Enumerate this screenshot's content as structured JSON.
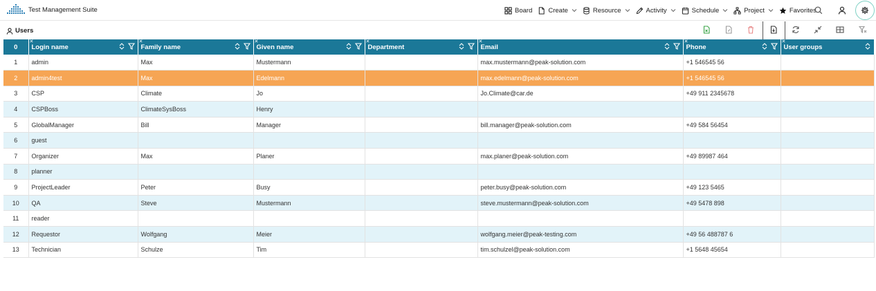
{
  "app": {
    "title": "Test Management Suite"
  },
  "nav": {
    "items": [
      {
        "label": "Board",
        "icon": "board-icon",
        "chevron": false
      },
      {
        "label": "Create",
        "icon": "document-icon",
        "chevron": true
      },
      {
        "label": "Resource",
        "icon": "database-icon",
        "chevron": true
      },
      {
        "label": "Activity",
        "icon": "pencil-icon",
        "chevron": true
      },
      {
        "label": "Schedule",
        "icon": "calendar-icon",
        "chevron": true
      },
      {
        "label": "Project",
        "icon": "hierarchy-icon",
        "chevron": true
      },
      {
        "label": "Favorites",
        "icon": "star-icon",
        "chevron": false
      }
    ]
  },
  "page": {
    "title": "Users"
  },
  "colors": {
    "header_bg": "#1b7898",
    "selected_row": "#f6a554",
    "stripe": "#e2f3f9",
    "accent_ring": "#7fd1c4"
  },
  "table": {
    "columns": [
      {
        "label": "0"
      },
      {
        "label": "Login name"
      },
      {
        "label": "Family name"
      },
      {
        "label": "Given name"
      },
      {
        "label": "Department"
      },
      {
        "label": "Email"
      },
      {
        "label": "Phone"
      },
      {
        "label": "User groups"
      }
    ],
    "selected_index": 1,
    "rows": [
      {
        "no": "1",
        "login": "admin",
        "family": "Max",
        "given": "Mustermann",
        "department": "",
        "email": "max.mustermann@peak-solution.com",
        "phone": "+1 546545 56",
        "groups": ""
      },
      {
        "no": "2",
        "login": "admin4test",
        "family": "Max",
        "given": "Edelmann",
        "department": "",
        "email": "max.edelmann@peak-solution.com",
        "phone": "+1 546545 56",
        "groups": ""
      },
      {
        "no": "3",
        "login": "CSP",
        "family": "Climate",
        "given": "Jo",
        "department": "",
        "email": "Jo.Climate@car.de",
        "phone": "+49 911 2345678",
        "groups": ""
      },
      {
        "no": "4",
        "login": "CSPBoss",
        "family": "ClimateSysBoss",
        "given": "Henry",
        "department": "",
        "email": "",
        "phone": "",
        "groups": ""
      },
      {
        "no": "5",
        "login": "GlobalManager",
        "family": "Bill",
        "given": "Manager",
        "department": "",
        "email": "bill.manager@peak-solution.com",
        "phone": "+49 584 56454",
        "groups": ""
      },
      {
        "no": "6",
        "login": "guest",
        "family": "",
        "given": "",
        "department": "",
        "email": "",
        "phone": "",
        "groups": ""
      },
      {
        "no": "7",
        "login": "Organizer",
        "family": "Max",
        "given": "Planer",
        "department": "",
        "email": "max.planer@peak-solution.com",
        "phone": "+49 89987 464",
        "groups": ""
      },
      {
        "no": "8",
        "login": "planner",
        "family": "",
        "given": "",
        "department": "",
        "email": "",
        "phone": "",
        "groups": ""
      },
      {
        "no": "9",
        "login": "ProjectLeader",
        "family": "Peter",
        "given": "Busy",
        "department": "",
        "email": "peter.busy@peak-solution.com",
        "phone": "+49 123 5465",
        "groups": ""
      },
      {
        "no": "10",
        "login": "QA",
        "family": "Steve",
        "given": "Mustermann",
        "department": "",
        "email": "steve.mustermann@peak-solution.com",
        "phone": "+49 5478 898",
        "groups": ""
      },
      {
        "no": "11",
        "login": "reader",
        "family": "",
        "given": "",
        "department": "",
        "email": "",
        "phone": "",
        "groups": ""
      },
      {
        "no": "12",
        "login": "Requestor",
        "family": "Wolfgang",
        "given": "Meier",
        "department": "",
        "email": "wolfgang.meier@peak-testing.com",
        "phone": "+49 56 488787 6",
        "groups": ""
      },
      {
        "no": "13",
        "login": "Technician",
        "family": "Schulze",
        "given": "Tim",
        "department": "",
        "email": "tim.schulzel@peak-solution.com",
        "phone": "+1 5648 45654",
        "groups": ""
      }
    ]
  }
}
